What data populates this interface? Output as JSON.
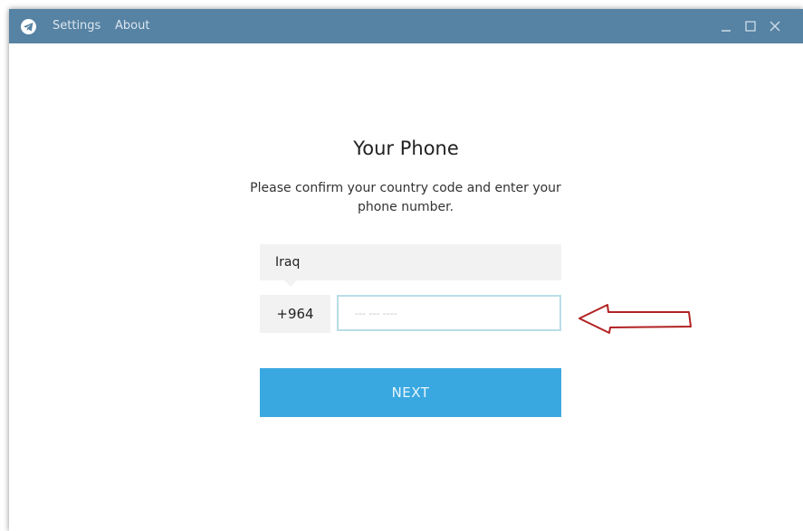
{
  "titlebar": {
    "menu": [
      "Settings",
      "About"
    ],
    "background_color": "#5682a3",
    "logo_icon": "telegram-paper-plane-icon",
    "controls": [
      "minimize-icon",
      "maximize-icon",
      "close-icon"
    ]
  },
  "login": {
    "title": "Your Phone",
    "description": "Please confirm your country code and enter your phone number.",
    "country": "Iraq",
    "country_code": "+964",
    "phone_placeholder": "--- --- ----",
    "phone_value": "",
    "next_label": "NEXT",
    "next_button_color": "#39a8e0"
  },
  "annotation": {
    "arrow_icon": "red-outline-arrow-left-icon",
    "arrow_color": "#b22222"
  }
}
